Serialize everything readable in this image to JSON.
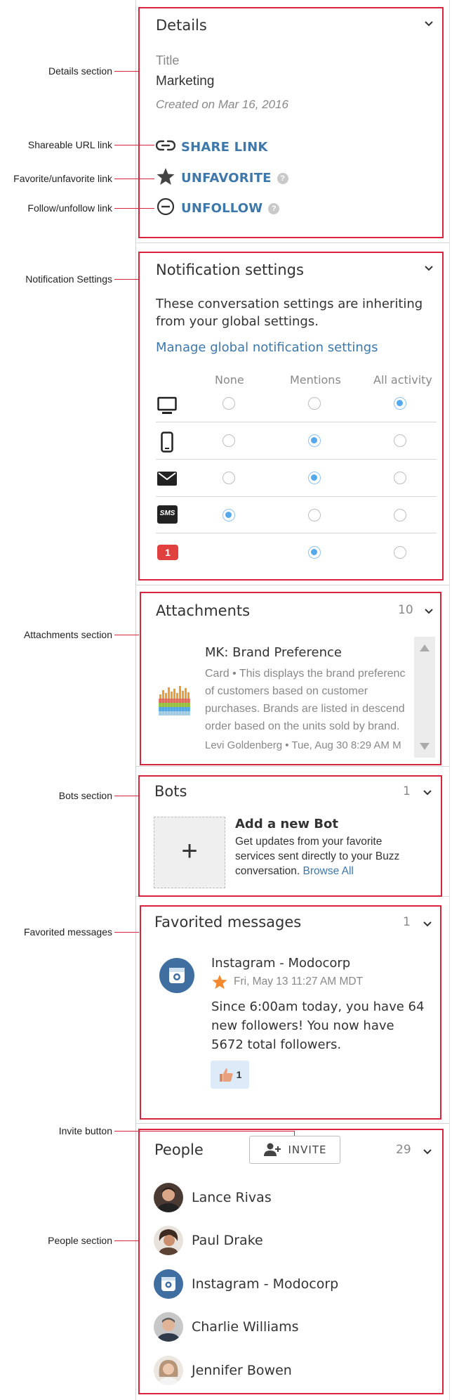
{
  "callouts": {
    "details": "Details section",
    "share": "Shareable URL link",
    "favorite": "Favorite/unfavorite link",
    "follow": "Follow/unfollow link",
    "notification": "Notification Settings",
    "attachments": "Attachments section",
    "bots": "Bots section",
    "favorited": "Favorited messages",
    "invite": "Invite button",
    "people": "People section"
  },
  "details": {
    "title": "Details",
    "field_label": "Title",
    "field_value": "Marketing",
    "created": "Created on Mar 16, 2016",
    "share_label": "SHARE LINK",
    "unfavorite_label": "UNFAVORITE",
    "unfollow_label": "UNFOLLOW",
    "help_glyph": "?"
  },
  "notifications": {
    "title": "Notification settings",
    "description": "These conversation settings are inheriting from your global settings.",
    "manage_link": "Manage global notification settings",
    "columns": [
      "None",
      "Mentions",
      "All activity"
    ],
    "sms_badge": "SMS",
    "count_badge": "1",
    "rows": [
      {
        "icon": "desktop-icon",
        "selected": "All activity"
      },
      {
        "icon": "mobile-icon",
        "selected": "Mentions"
      },
      {
        "icon": "email-icon",
        "selected": "Mentions"
      },
      {
        "icon": "sms-icon",
        "selected": "None"
      },
      {
        "icon": "badge-icon",
        "selected": "Mentions"
      }
    ]
  },
  "attachments": {
    "title": "Attachments",
    "count": "10",
    "item_title": "MK: Brand Preference",
    "item_desc_1": "Card • This displays the brand preferenc",
    "item_desc_2": "of customers based on customer",
    "item_desc_3": "purchases. Brands are listed in descend",
    "item_desc_4": "order based on the units sold by brand.",
    "item_meta": "Levi Goldenberg • Tue, Aug 30 8:29 AM M"
  },
  "bots": {
    "title": "Bots",
    "count": "1",
    "add_title": "Add a new Bot",
    "add_desc": "Get updates from your favorite services sent directly to your Buzz conversation.",
    "browse_link": "Browse All",
    "plus_glyph": "+"
  },
  "favorited": {
    "title": "Favorited messages",
    "count": "1",
    "sender": "Instagram - Modocorp",
    "date": "Fri, May 13 11:27 AM MDT",
    "body": "Since 6:00am today, you have 64 new followers! You now have 5672 total followers.",
    "reaction_count": "1"
  },
  "people": {
    "title": "People",
    "invite_label": "INVITE",
    "count": "29",
    "members": [
      {
        "name": "Lance Rivas",
        "color": "#4a3a34"
      },
      {
        "name": "Paul Drake",
        "color": "#5c4232"
      },
      {
        "name": "Instagram - Modocorp",
        "color": "#3e6fa0"
      },
      {
        "name": "Charlie Williams",
        "color": "#8a8a8a"
      },
      {
        "name": "Jennifer Bowen",
        "color": "#b59478"
      }
    ]
  },
  "colors": {
    "accent_link": "#3e77aa",
    "annotation_red": "#d8243c",
    "radio_selected": "#55a8ec",
    "alert_badge": "#e0413f"
  }
}
